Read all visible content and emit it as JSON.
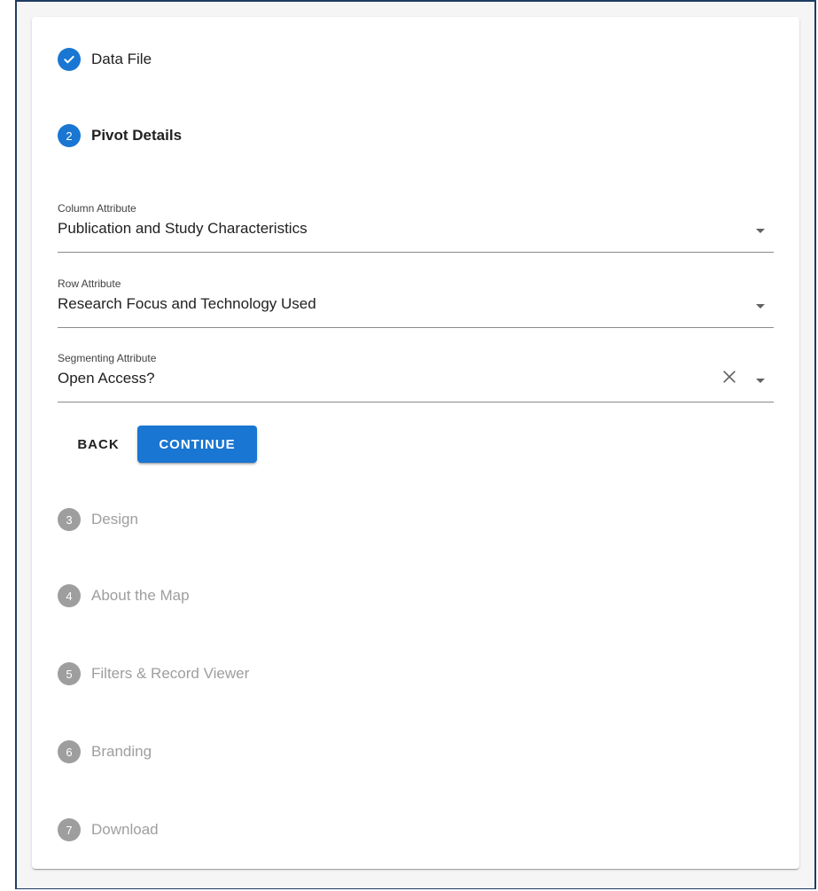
{
  "steps": [
    {
      "number": "",
      "label": "Data File",
      "state": "done"
    },
    {
      "number": "2",
      "label": "Pivot Details",
      "state": "active"
    },
    {
      "number": "3",
      "label": "Design",
      "state": "inactive"
    },
    {
      "number": "4",
      "label": "About the Map",
      "state": "inactive"
    },
    {
      "number": "5",
      "label": "Filters & Record Viewer",
      "state": "inactive"
    },
    {
      "number": "6",
      "label": "Branding",
      "state": "inactive"
    },
    {
      "number": "7",
      "label": "Download",
      "state": "inactive"
    }
  ],
  "fields": {
    "column": {
      "label": "Column Attribute",
      "value": "Publication and Study Characteristics"
    },
    "row": {
      "label": "Row Attribute",
      "value": "Research Focus and Technology Used"
    },
    "segmenting": {
      "label": "Segmenting Attribute",
      "value": "Open Access?"
    }
  },
  "buttons": {
    "back": "BACK",
    "continue": "CONTINUE"
  },
  "colors": {
    "primary": "#1976d2",
    "inactive": "#9e9e9e"
  },
  "icons": {
    "done": "check-icon",
    "clear": "close-icon",
    "dropdown": "caret-down-icon"
  }
}
